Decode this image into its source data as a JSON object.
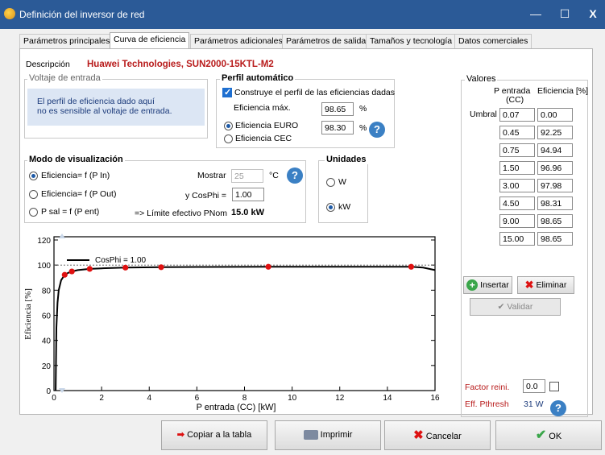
{
  "window": {
    "title": "Definición del inversor de red",
    "minimize": "—",
    "maximize": "☐",
    "close": "X"
  },
  "tabs": [
    {
      "label": "Parámetros principales"
    },
    {
      "label": "Curva de eficiencia"
    },
    {
      "label": "Parámetros adicionales"
    },
    {
      "label": "Parámetros de salida"
    },
    {
      "label": "Tamaños y tecnología"
    },
    {
      "label": "Datos comerciales"
    }
  ],
  "description": {
    "label": "Descripción",
    "value": "Huawei Technologies, SUN2000-15KTL-M2"
  },
  "voltage": {
    "title": "Voltaje de entrada",
    "line1": "El perfil de eficiencia dado aquí",
    "line2": "no es sensible al voltaje de entrada."
  },
  "profile": {
    "title": "Perfil automático",
    "check_label": "Construye el perfil de las eficiencias dadas",
    "max_label": "Eficiencia máx.",
    "max_value": "98.65",
    "max_unit": "%",
    "euro_label": "Eficiencia EURO",
    "euro_value": "98.30",
    "euro_unit": "%",
    "cec_label": "Eficiencia CEC"
  },
  "display": {
    "title": "Modo de visualización",
    "opt1": "Eficiencia= f (P In)",
    "opt2": "Eficiencia= f (P Out)",
    "opt3": "P sal = f (P ent)",
    "show_label": "Mostrar",
    "show_value": "25",
    "show_unit": "°C",
    "cosphi_label": "y CosPhi =",
    "cosphi_value": "1.00",
    "limit_label": "=> Límite efectivo PNom",
    "limit_value": "15.0 kW"
  },
  "units": {
    "title": "Unidades",
    "w": "W",
    "kw": "kW"
  },
  "values": {
    "title": "Valores",
    "col1": "P entrada",
    "col1b": "(CC)",
    "col2": "Eficiencia [%]",
    "threshold_label": "Umbral",
    "rows": [
      {
        "p": "0.07",
        "e": "0.00"
      },
      {
        "p": "0.45",
        "e": "92.25"
      },
      {
        "p": "0.75",
        "e": "94.94"
      },
      {
        "p": "1.50",
        "e": "96.96"
      },
      {
        "p": "3.00",
        "e": "97.98"
      },
      {
        "p": "4.50",
        "e": "98.31"
      },
      {
        "p": "9.00",
        "e": "98.65"
      },
      {
        "p": "15.00",
        "e": "98.65"
      }
    ],
    "insert_label": "Insertar",
    "delete_label": "Eliminar",
    "validate_label": "Validar"
  },
  "factor": {
    "label": "Factor reini.",
    "value": "0.0",
    "pthresh_label": "Eff. Pthresh",
    "pthresh_value": "31 W"
  },
  "buttons": {
    "copy": "Copiar a la tabla",
    "print": "Imprimir",
    "cancel": "Cancelar",
    "ok": "OK"
  },
  "colors": {
    "titlebar": "#2b5a97",
    "accent_red": "#b81b1b",
    "marker": "#e01010"
  },
  "chart_data": {
    "type": "line",
    "xlabel": "P entrada (CC) [kW]",
    "ylabel": "Eficiencia [%]",
    "xlim": [
      0,
      16
    ],
    "ylim": [
      0,
      120
    ],
    "xticks": [
      "0",
      "2",
      "4",
      "6",
      "8",
      "10",
      "12",
      "14",
      "16"
    ],
    "yticks": [
      "0",
      "20",
      "40",
      "60",
      "80",
      "100",
      "120"
    ],
    "legend": "CosPhi = 1.00",
    "curve": {
      "x": [
        0.07,
        0.1,
        0.15,
        0.2,
        0.3,
        0.45,
        0.6,
        0.75,
        1.0,
        1.5,
        2.0,
        3.0,
        4.5,
        6.0,
        9.0,
        12.0,
        15.0,
        15.5,
        16.0
      ],
      "y": [
        0,
        50,
        70,
        80,
        88,
        92.25,
        93.8,
        94.94,
        96.0,
        96.96,
        97.4,
        97.98,
        98.31,
        98.5,
        98.65,
        98.65,
        98.65,
        98.0,
        96.0
      ]
    },
    "points": {
      "x": [
        0.45,
        0.75,
        1.5,
        3.0,
        4.5,
        9.0,
        15.0
      ],
      "y": [
        92.25,
        94.94,
        96.96,
        97.98,
        98.31,
        98.65,
        98.65
      ]
    }
  }
}
